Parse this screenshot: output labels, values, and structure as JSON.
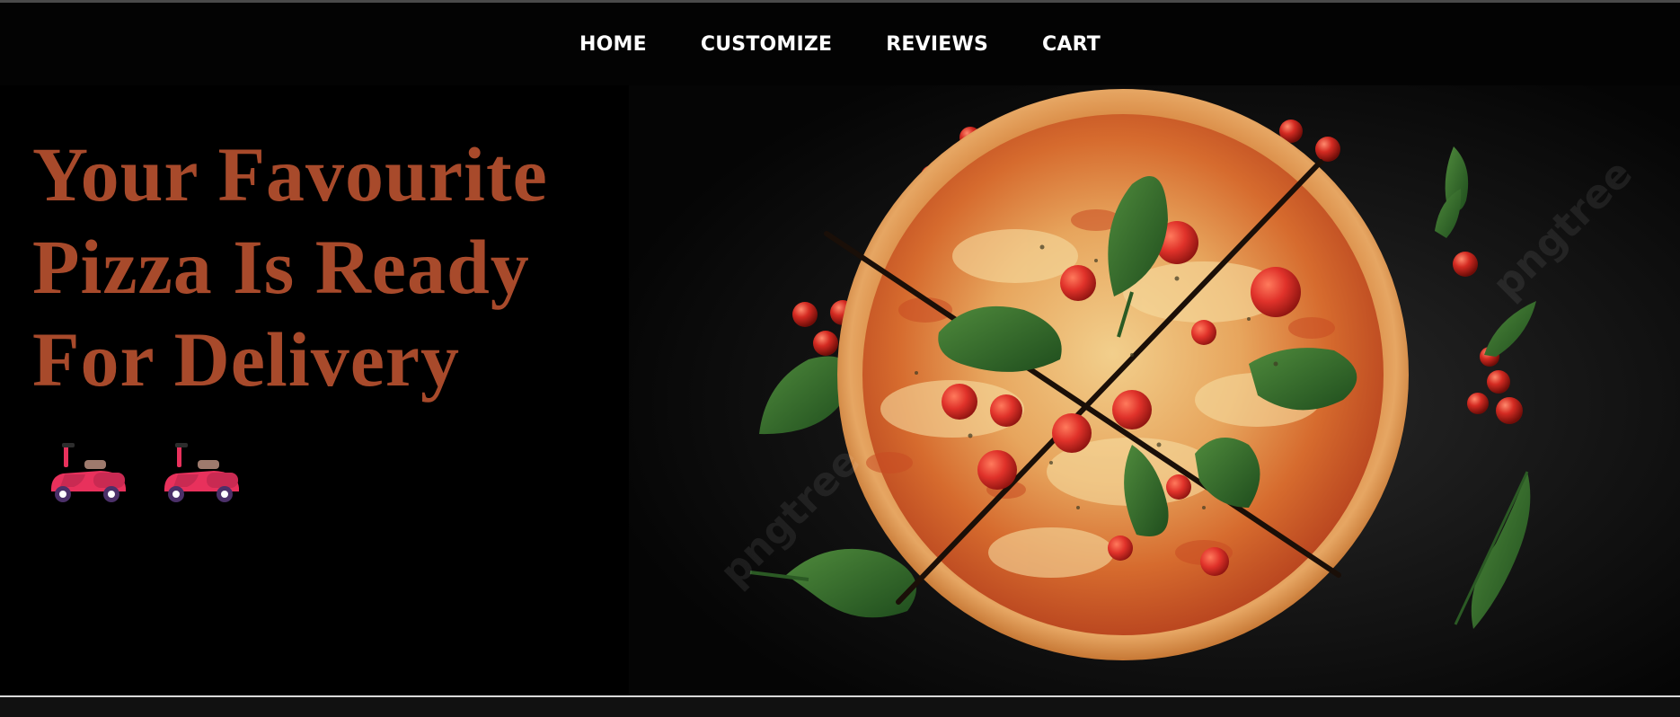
{
  "nav": {
    "items": [
      {
        "label": "HOME"
      },
      {
        "label": "CUSTOMIZE"
      },
      {
        "label": "REVIEWS"
      },
      {
        "label": "CART"
      }
    ]
  },
  "hero": {
    "headline_lines": [
      "Your Favourite",
      "Pizza Is Ready",
      "For Delivery"
    ],
    "icons": [
      "scooter-icon",
      "scooter-icon"
    ],
    "watermark": "pngtree"
  },
  "colors": {
    "background": "#000000",
    "headline": "#a84a2b",
    "nav_text": "#ffffff",
    "scooter_body": "#e8315c"
  }
}
